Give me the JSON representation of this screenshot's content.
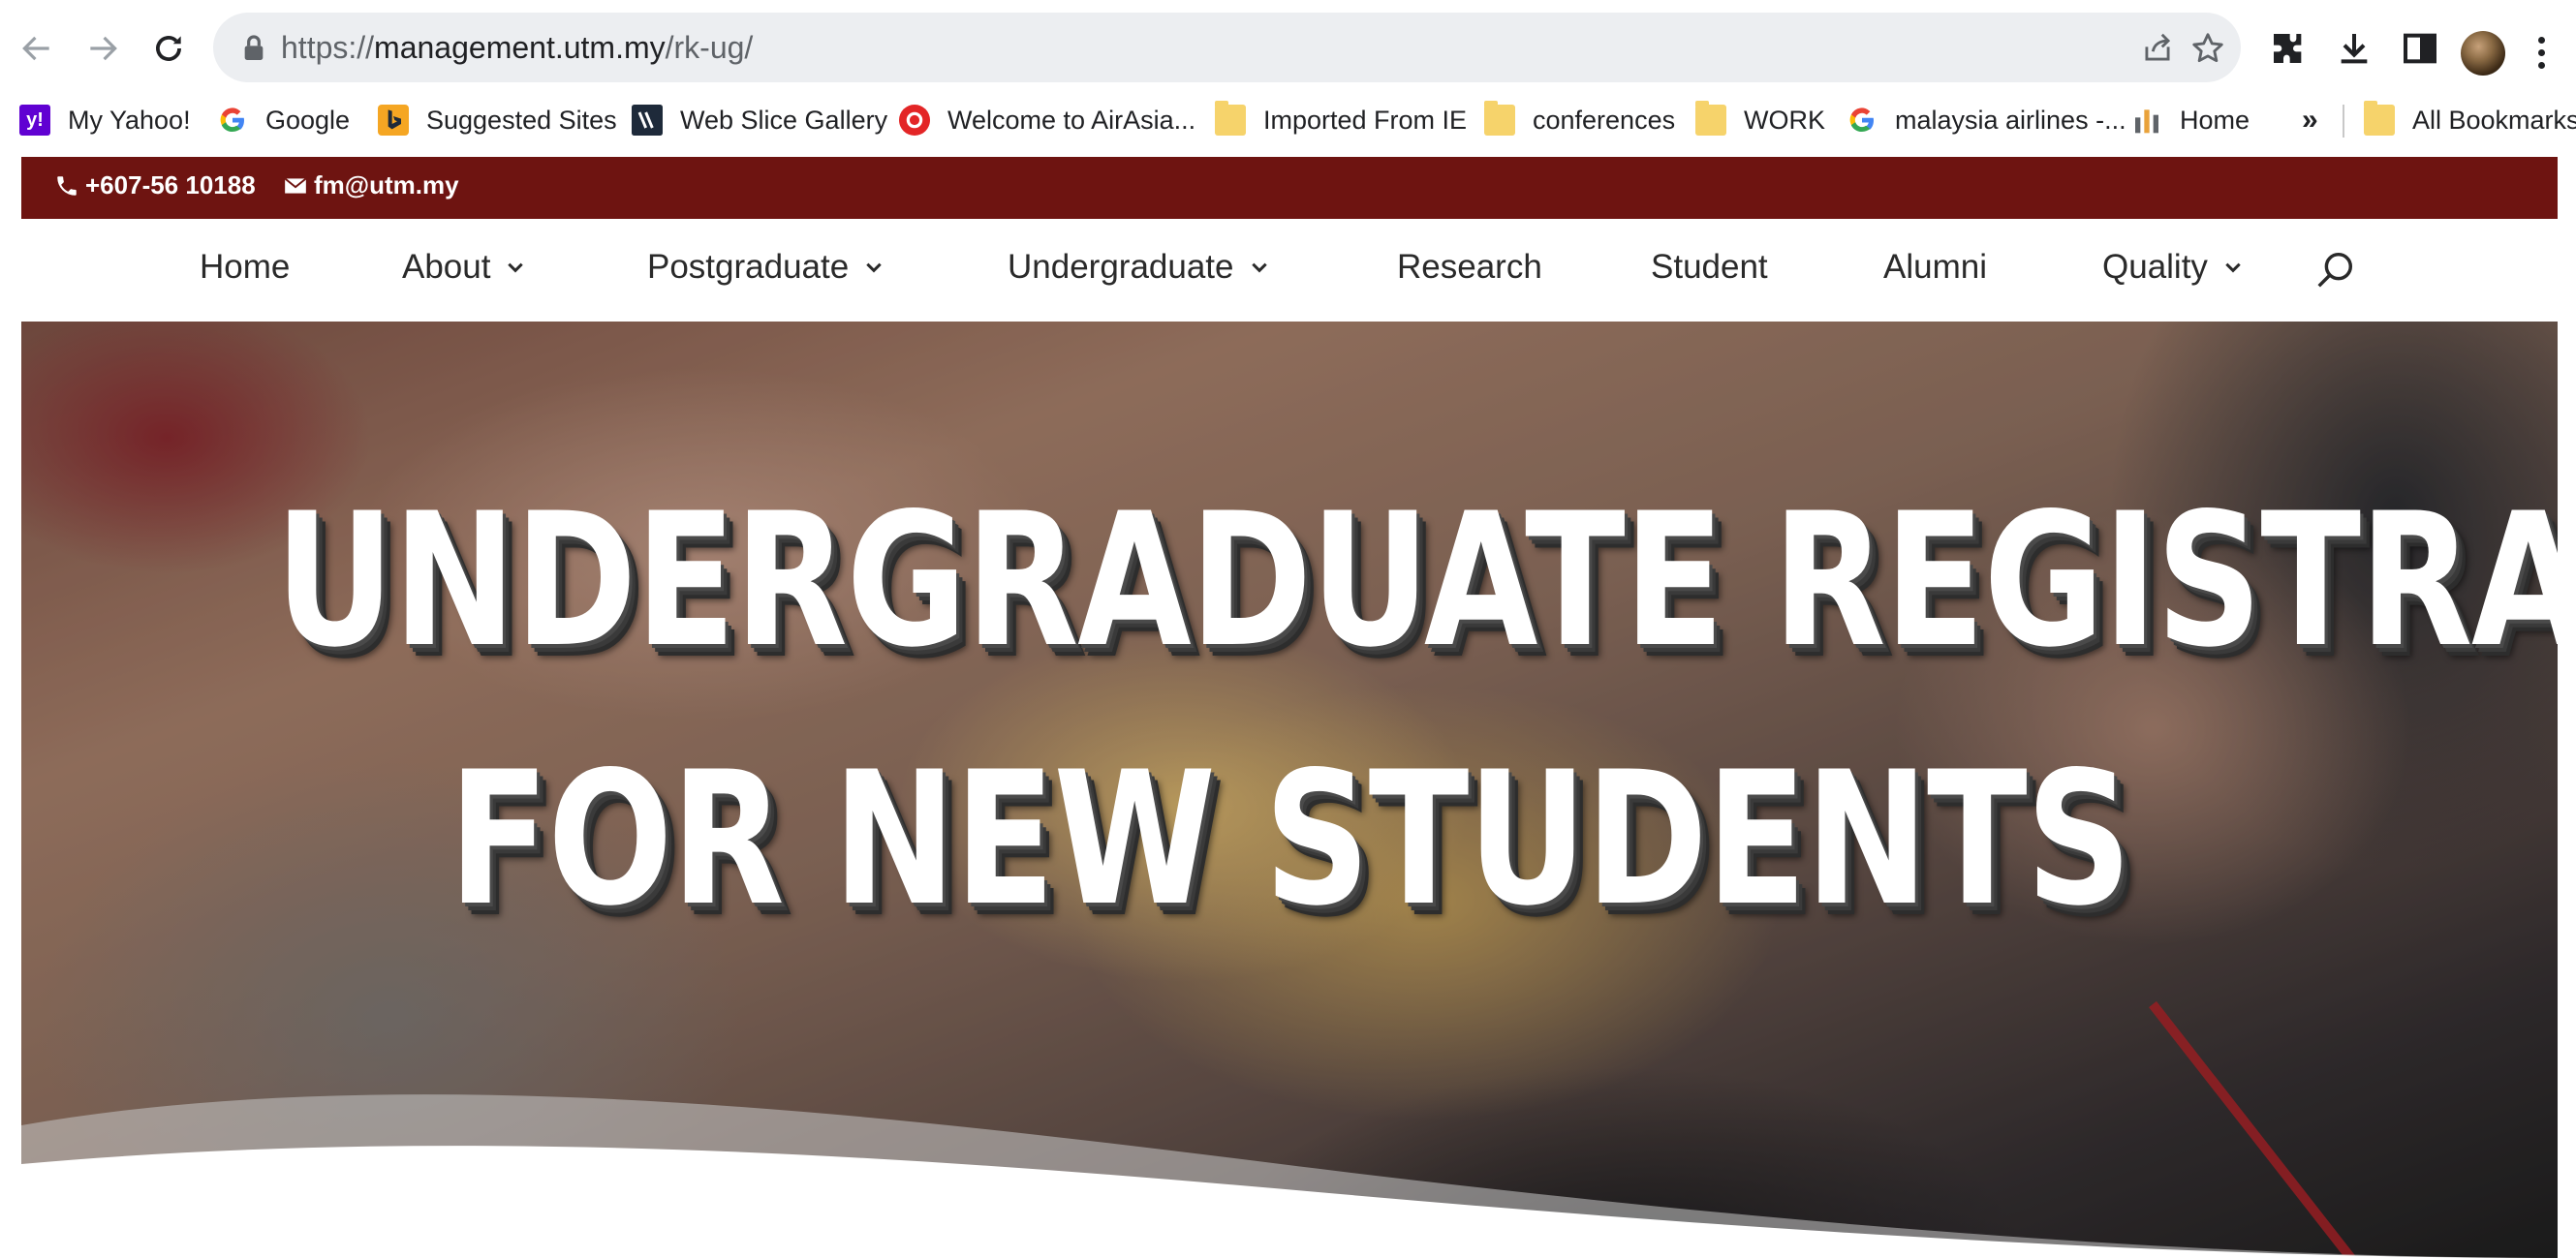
{
  "browser": {
    "url_scheme": "https://",
    "url_host": "management.utm.my",
    "url_path": "/rk-ug/"
  },
  "bookmarks": [
    {
      "label": "My Yahoo!",
      "icon": "yahoo-icon",
      "color": "#6001d2"
    },
    {
      "label": "Google",
      "icon": "google-icon",
      "color": "#4285f4"
    },
    {
      "label": "Suggested Sites",
      "icon": "bing-icon",
      "color": "#f5a623"
    },
    {
      "label": "Web Slice Gallery",
      "icon": "web-slice-icon",
      "color": "#1e2a3a"
    },
    {
      "label": "Welcome to AirAsia...",
      "icon": "airasia-icon",
      "color": "#e32526"
    },
    {
      "label": "Imported From IE",
      "icon": "folder-icon",
      "color": "#f6d36b"
    },
    {
      "label": "conferences",
      "icon": "folder-icon",
      "color": "#f6d36b"
    },
    {
      "label": "WORK",
      "icon": "folder-icon",
      "color": "#f6d36b"
    },
    {
      "label": "malaysia airlines -...",
      "icon": "google-icon",
      "color": "#4285f4"
    },
    {
      "label": "Home",
      "icon": "bar-chart-icon",
      "color": "#5f6368"
    }
  ],
  "bookmarks_overflow": "»",
  "all_bookmarks": "All Bookmarks",
  "site": {
    "phone": "+607-56 10188",
    "email": "fm@utm.my",
    "brand_color": "#6e1411",
    "nav": [
      {
        "label": "Home",
        "dropdown": false
      },
      {
        "label": "About",
        "dropdown": true
      },
      {
        "label": "Postgraduate",
        "dropdown": true
      },
      {
        "label": "Undergraduate",
        "dropdown": true
      },
      {
        "label": "Research",
        "dropdown": false
      },
      {
        "label": "Student",
        "dropdown": false
      },
      {
        "label": "Alumni",
        "dropdown": false
      },
      {
        "label": "Quality",
        "dropdown": true
      }
    ],
    "hero": {
      "line1": "UNDERGRADUATE REGISTRATION KIT",
      "line2": "FOR NEW STUDENTS"
    }
  }
}
